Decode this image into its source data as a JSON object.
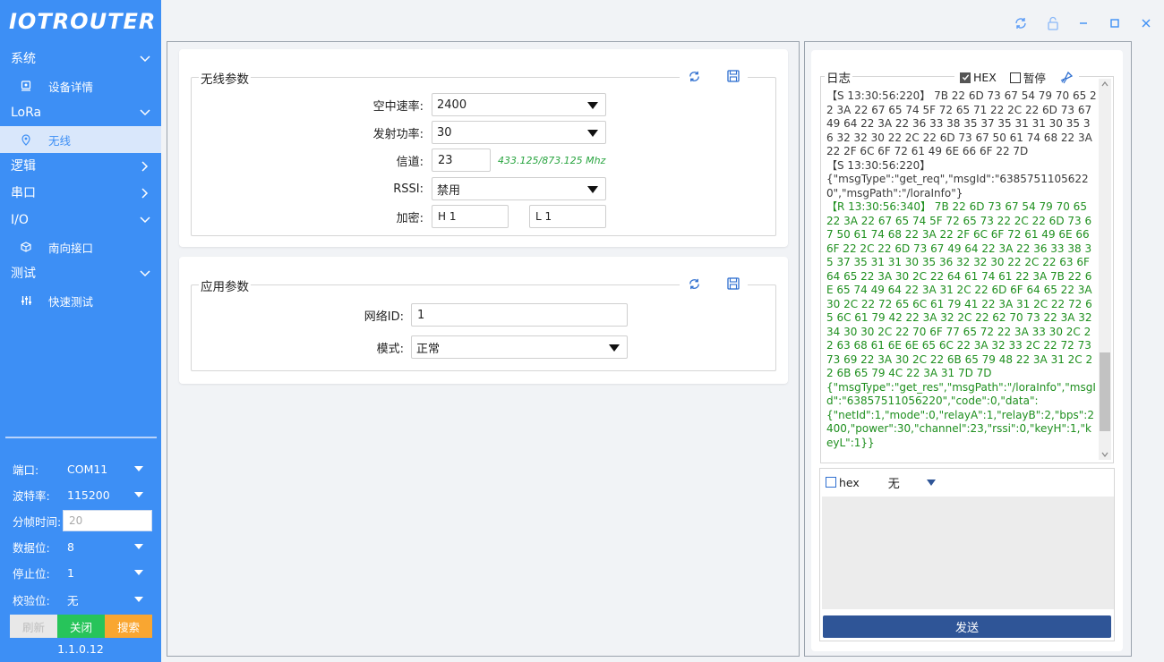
{
  "app": {
    "logo": "IOTROUTER",
    "version": "1.1.0.12"
  },
  "nav": {
    "system": "系统",
    "device_detail": "设备详情",
    "lora": "LoRa",
    "wireless": "无线",
    "logic": "逻辑",
    "serial": "串口",
    "io": "I/O",
    "south_interface": "南向接口",
    "test": "测试",
    "quick_test": "快速测试"
  },
  "serial": {
    "port_label": "端口:",
    "port_value": "COM11",
    "baud_label": "波特率:",
    "baud_value": "115200",
    "frame_label": "分帧时间:",
    "frame_value": "20",
    "databits_label": "数据位:",
    "databits_value": "8",
    "stopbits_label": "停止位:",
    "stopbits_value": "1",
    "parity_label": "校验位:",
    "parity_value": "无",
    "refresh": "刷新",
    "close": "关闭",
    "search": "搜索"
  },
  "wireless": {
    "title": "无线参数",
    "air_rate_label": "空中速率:",
    "air_rate_value": "2400",
    "tx_power_label": "发射功率:",
    "tx_power_value": "30",
    "channel_label": "信道:",
    "channel_value": "23",
    "channel_hint": "433.125/873.125 Mhz",
    "rssi_label": "RSSI:",
    "rssi_value": "禁用",
    "encrypt_label": "加密:",
    "key_h": "H 1",
    "key_l": "L 1"
  },
  "application": {
    "title": "应用参数",
    "netid_label": "网络ID:",
    "netid_value": "1",
    "mode_label": "模式:",
    "mode_value": "正常"
  },
  "log": {
    "title": "日志",
    "hex_label": "HEX",
    "hex_checked": true,
    "pause_label": "暂停",
    "pause_checked": false,
    "lines": [
      {
        "type": "s",
        "text": "【S 13:30:56:220】 7B 22 6D 73 67 54 79 70 65 22 3A 22 67 65 74 5F 72 65 71 22 2C 22 6D 73 67 49 64 22 3A 22 36 33 38 35 37 35 31 31 30 35 36 32 32 30 22 2C 22 6D 73 67 50 61 74 68 22 3A 22 2F 6C 6F 72 61 49 6E 66 6F 22 7D"
      },
      {
        "type": "s",
        "text": "【S 13:30:56:220】"
      },
      {
        "type": "s",
        "text": "{\"msgType\":\"get_req\",\"msgId\":\"63857511056220\",\"msgPath\":\"/loraInfo\"}"
      },
      {
        "type": "r",
        "text": "【R 13:30:56:340】 7B 22 6D 73 67 54 79 70 65 22 3A 22 67 65 74 5F 72 65 73 22 2C 22 6D 73 67 50 61 74 68 22 3A 22 2F 6C 6F 72 61 49 6E 66 6F 22 2C 22 6D 73 67 49 64 22 3A 22 36 33 38 35 37 35 31 31 30 35 36 32 32 30 22 2C 22 63 6F 64 65 22 3A 30 2C 22 64 61 74 61 22 3A 7B 22 6E 65 74 49 64 22 3A 31 2C 22 6D 6F 64 65 22 3A 30 2C 22 72 65 6C 61 79 41 22 3A 31 2C 22 72 65 6C 61 79 42 22 3A 32 2C 22 62 70 73 22 3A 32 34 30 30 2C 22 70 6F 77 65 72 22 3A 33 30 2C 22 63 68 61 6E 6E 65 6C 22 3A 32 33 2C 22 72 73 73 69 22 3A 30 2C 22 6B 65 79 48 22 3A 31 2C 22 6B 65 79 4C 22 3A 31 7D 7D"
      },
      {
        "type": "r",
        "text": "{\"msgType\":\"get_res\",\"msgPath\":\"/loraInfo\",\"msgId\":\"63857511056220\",\"code\":0,\"data\":"
      },
      {
        "type": "r",
        "text": "{\"netId\":1,\"mode\":0,\"relayA\":1,\"relayB\":2,\"bps\":2400,\"power\":30,\"channel\":23,\"rssi\":0,\"keyH\":1,\"keyL\":1}}"
      }
    ]
  },
  "send": {
    "hex_label": "hex",
    "hex_checked": false,
    "suffix_value": "无",
    "send_label": "发送"
  }
}
